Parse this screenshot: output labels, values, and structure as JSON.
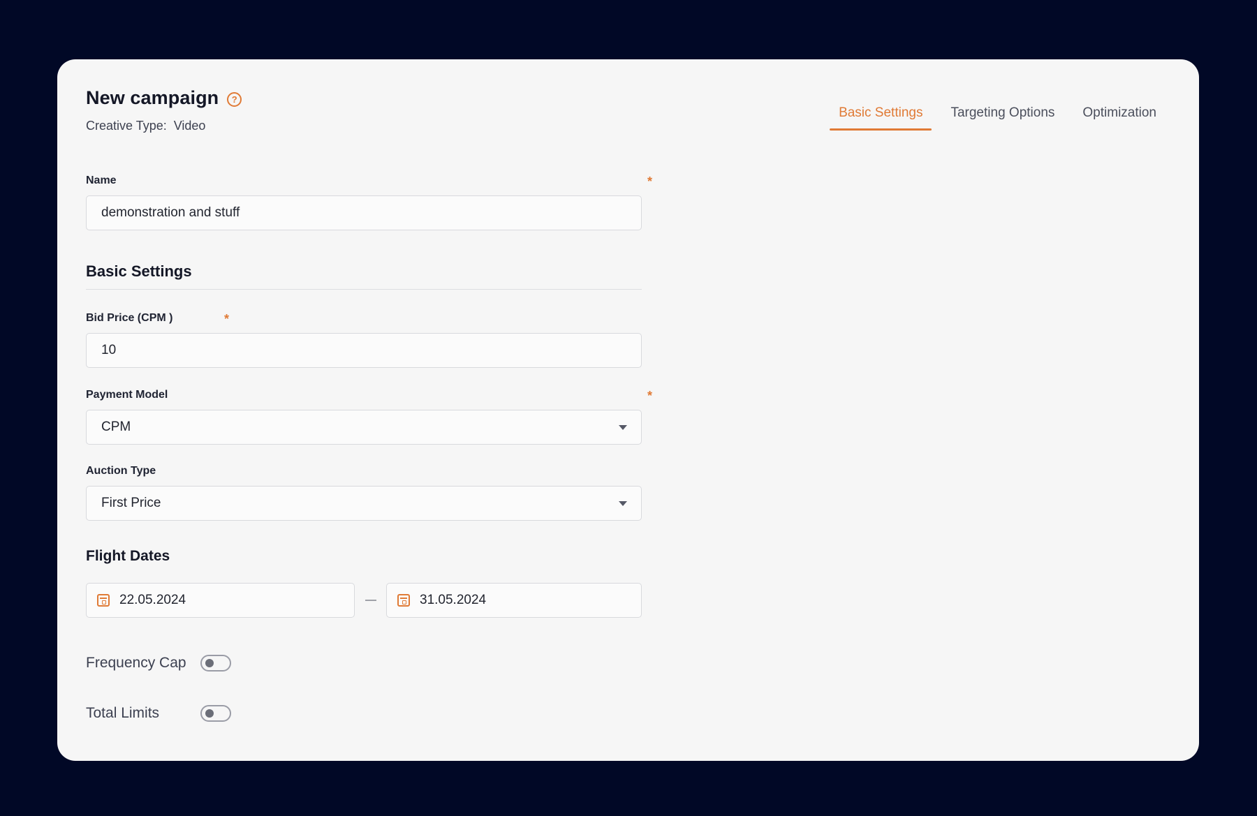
{
  "header": {
    "title": "New campaign",
    "help_icon": "question-circle-icon",
    "creative_type_label": "Creative Type:",
    "creative_type_value": "Video"
  },
  "tabs": [
    {
      "label": "Basic Settings",
      "active": true
    },
    {
      "label": "Targeting Options",
      "active": false
    },
    {
      "label": "Optimization",
      "active": false
    }
  ],
  "form": {
    "name": {
      "label": "Name",
      "value": "demonstration and stuff",
      "required_mark": "*"
    },
    "basic_settings_title": "Basic Settings",
    "bid_price": {
      "label": "Bid Price (CPM )",
      "value": "10",
      "required_mark": "*"
    },
    "payment_model": {
      "label": "Payment Model",
      "value": "CPM",
      "required_mark": "*"
    },
    "auction_type": {
      "label": "Auction Type",
      "value": "First Price"
    },
    "flight_dates": {
      "title": "Flight Dates",
      "start": "22.05.2024",
      "end": "31.05.2024",
      "icon": "calendar-icon"
    },
    "frequency_cap": {
      "label": "Frequency Cap",
      "enabled": false
    },
    "total_limits": {
      "label": "Total Limits",
      "enabled": false
    }
  },
  "colors": {
    "accent": "#e07a35",
    "background": "#010826",
    "card": "#f6f6f6"
  }
}
